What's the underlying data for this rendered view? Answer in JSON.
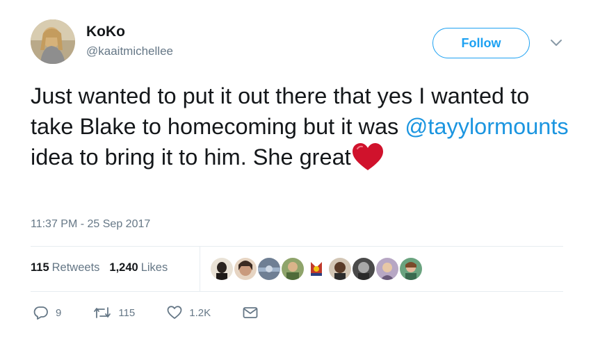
{
  "user": {
    "name": "KoKo",
    "handle": "@kaaitmichellee"
  },
  "follow_label": "Follow",
  "tweet": {
    "text_before": "Just wanted to put it out there that yes I wanted to take Blake to homecoming but it was ",
    "mention": "@tayylormounts",
    "text_after": " idea to bring it to him. She great",
    "emoji": "red-heart"
  },
  "timestamp": "11:37 PM - 25 Sep 2017",
  "stats": {
    "retweets_count": "115",
    "retweets_label": "Retweets",
    "likes_count": "1,240",
    "likes_label": "Likes"
  },
  "actions": {
    "reply_count": "9",
    "retweet_count": "115",
    "like_count": "1.2K"
  },
  "colors": {
    "accent": "#1da1f2",
    "mention": "#1b95e0",
    "muted": "#657786",
    "heart": "#e0245e"
  },
  "icons": [
    "chevron-down-icon",
    "reply-icon",
    "retweet-icon",
    "like-icon",
    "dm-icon"
  ]
}
